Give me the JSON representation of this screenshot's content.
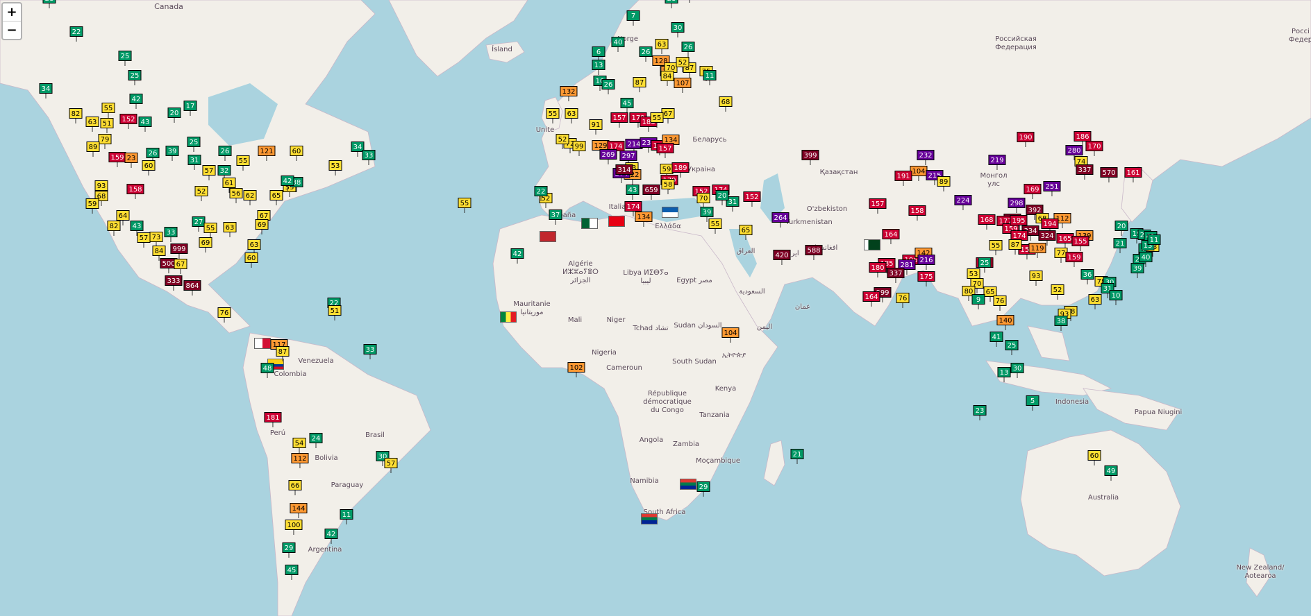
{
  "zoom": {
    "in_label": "+",
    "out_label": "−"
  },
  "labels": {
    "canada": "Canada",
    "island": "Ísland",
    "norge": "Norge",
    "uk": "Unite",
    "russia": "Российская\nФедерация",
    "russia_edge": "Россі\nФедер",
    "belarus": "Беларусь",
    "ukraine": "Украіна",
    "espana": "España",
    "italia": "Italia",
    "ellada": "Ελλάδα",
    "kazakhstan": "Қазақстан",
    "mongolia": "Монгол\nулс",
    "uzbekistan": "O'zbekiston",
    "turkmenistan": "Turkmenistan",
    "afghanistan": "افغانستان",
    "iraq": "العراق",
    "iran": "ایران",
    "saudi": "السعودية",
    "oman": "عمان",
    "yemen": "اليمن",
    "algerie": "Algérie\nⵍⵣⵣⴰⵢⴻⵔ\nالجزائر",
    "libya": "Libya ⵍⵉⴱⵢⴰ\nليبيا",
    "egypt": "Egypt مصر",
    "mauritanie": "Mauritanie\nموريتانيا",
    "mali": "Mali",
    "niger": "Niger",
    "tchad": "Tchad تشاد",
    "sudan": "Sudan السودان",
    "nigeria": "Nigeria",
    "cameroun": "Cameroun",
    "south_sudan": "South Sudan",
    "ethiopia": "ኢትዮጵያ",
    "kenya": "Kenya",
    "rdc": "République\ndémocratique\ndu Congo",
    "tanzania": "Tanzania",
    "angola": "Angola",
    "zambia": "Zambia",
    "mocambique": "Moçambique",
    "namibia": "Namibia",
    "south_africa": "South Africa",
    "venezuela": "Venezuela",
    "colombia": "Colombia",
    "brasil": "Brasil",
    "peru": "Perú",
    "bolivia": "Bolivia",
    "paraguay": "Paraguay",
    "argentina": "Argentina",
    "indonesia": "Indonesia",
    "papua": "Papua Niugini",
    "australia": "Australia",
    "new_zealand": "New Zealand/\nAotearoa"
  },
  "stations": [
    {
      "v": "28",
      "c": "g"
    },
    {
      "v": "22",
      "c": "g"
    },
    {
      "v": "25",
      "c": "g"
    },
    {
      "v": "25",
      "c": "g"
    },
    {
      "v": "34",
      "c": "g"
    },
    {
      "v": "82",
      "c": "y"
    },
    {
      "v": "55",
      "c": "y"
    },
    {
      "v": "63",
      "c": "y"
    },
    {
      "v": "51",
      "c": "y"
    },
    {
      "v": "152",
      "c": "r"
    },
    {
      "v": "43",
      "c": "g"
    },
    {
      "v": "42",
      "c": "g"
    },
    {
      "v": "20",
      "c": "g"
    },
    {
      "v": "17",
      "c": "g"
    },
    {
      "v": "79",
      "c": "y"
    },
    {
      "v": "89",
      "c": "y"
    },
    {
      "v": "159",
      "c": "r"
    },
    {
      "v": "23",
      "c": "o"
    },
    {
      "v": "26",
      "c": "g"
    },
    {
      "v": "39",
      "c": "g"
    },
    {
      "v": "25",
      "c": "g"
    },
    {
      "v": "26",
      "c": "g"
    },
    {
      "v": "121",
      "c": "o"
    },
    {
      "v": "60",
      "c": "y"
    },
    {
      "v": "55",
      "c": "y"
    },
    {
      "v": "34",
      "c": "g"
    },
    {
      "v": "33",
      "c": "g"
    },
    {
      "v": "60",
      "c": "y"
    },
    {
      "v": "31",
      "c": "g"
    },
    {
      "v": "57",
      "c": "y"
    },
    {
      "v": "32",
      "c": "g"
    },
    {
      "v": "158",
      "c": "r"
    },
    {
      "v": "93",
      "c": "y"
    },
    {
      "v": "68",
      "c": "y"
    },
    {
      "v": "52",
      "c": "y"
    },
    {
      "v": "61",
      "c": "y"
    },
    {
      "v": "56",
      "c": "y"
    },
    {
      "v": "62",
      "c": "y"
    },
    {
      "v": "65",
      "c": "y"
    },
    {
      "v": "53",
      "c": "y"
    },
    {
      "v": "38",
      "c": "g"
    },
    {
      "v": "42",
      "c": "g"
    },
    {
      "v": "53",
      "c": "y"
    },
    {
      "v": "59",
      "c": "y"
    },
    {
      "v": "64",
      "c": "y"
    },
    {
      "v": "82",
      "c": "y"
    },
    {
      "v": "43",
      "c": "g"
    },
    {
      "v": "57",
      "c": "y"
    },
    {
      "v": "73",
      "c": "y"
    },
    {
      "v": "33",
      "c": "g"
    },
    {
      "v": "27",
      "c": "g"
    },
    {
      "v": "55",
      "c": "y"
    },
    {
      "v": "63",
      "c": "y"
    },
    {
      "v": "67",
      "c": "y"
    },
    {
      "v": "69",
      "c": "y"
    },
    {
      "v": "84",
      "c": "y"
    },
    {
      "v": "999",
      "c": "d"
    },
    {
      "v": "69",
      "c": "y"
    },
    {
      "v": "63",
      "c": "y"
    },
    {
      "v": "60",
      "c": "y"
    },
    {
      "v": "500",
      "c": "d"
    },
    {
      "v": "67",
      "c": "y"
    },
    {
      "v": "333",
      "c": "d"
    },
    {
      "v": "864",
      "c": "d"
    },
    {
      "v": "76",
      "c": "y"
    },
    {
      "v": "22",
      "c": "g"
    },
    {
      "v": "51",
      "c": "y"
    },
    {
      "v": "33",
      "c": "g"
    },
    {
      "v": "117",
      "c": "o"
    },
    {
      "v": "87",
      "c": "y"
    },
    {
      "v": "48",
      "c": "g"
    },
    {
      "v": "181",
      "c": "r"
    },
    {
      "v": "24",
      "c": "g"
    },
    {
      "v": "54",
      "c": "y"
    },
    {
      "v": "112",
      "c": "o"
    },
    {
      "v": "30",
      "c": "g"
    },
    {
      "v": "57",
      "c": "y"
    },
    {
      "v": "66",
      "c": "y"
    },
    {
      "v": "144",
      "c": "o"
    },
    {
      "v": "100",
      "c": "y"
    },
    {
      "v": "11",
      "c": "g"
    },
    {
      "v": "42",
      "c": "g"
    },
    {
      "v": "29",
      "c": "g"
    },
    {
      "v": "45",
      "c": "g"
    },
    {
      "v": "55",
      "c": "y"
    },
    {
      "v": "42",
      "c": "g"
    },
    {
      "v": "102",
      "c": "o"
    },
    {
      "v": "104",
      "c": "o"
    },
    {
      "v": "29",
      "c": "g"
    },
    {
      "v": "21",
      "c": "g"
    },
    {
      "v": "7",
      "c": "g"
    },
    {
      "v": "28",
      "c": "g"
    },
    {
      "v": "27",
      "c": "g"
    },
    {
      "v": "30",
      "c": "g"
    },
    {
      "v": "40",
      "c": "g"
    },
    {
      "v": "6",
      "c": "g"
    },
    {
      "v": "26",
      "c": "g"
    },
    {
      "v": "63",
      "c": "y"
    },
    {
      "v": "26",
      "c": "g"
    },
    {
      "v": "79",
      "c": "o"
    },
    {
      "v": "128",
      "c": "o"
    },
    {
      "v": "70",
      "c": "y"
    },
    {
      "v": "87",
      "c": "y"
    },
    {
      "v": "52",
      "c": "y"
    },
    {
      "v": "75",
      "c": "y"
    },
    {
      "v": "11",
      "c": "g"
    },
    {
      "v": "13",
      "c": "g"
    },
    {
      "v": "10",
      "c": "g"
    },
    {
      "v": "26",
      "c": "g"
    },
    {
      "v": "87",
      "c": "y"
    },
    {
      "v": "84",
      "c": "y"
    },
    {
      "v": "107",
      "c": "o"
    },
    {
      "v": "68",
      "c": "y"
    },
    {
      "v": "132",
      "c": "o"
    },
    {
      "v": "45",
      "c": "g"
    },
    {
      "v": "55",
      "c": "y"
    },
    {
      "v": "63",
      "c": "y"
    },
    {
      "v": "67",
      "c": "y"
    },
    {
      "v": "91",
      "c": "y"
    },
    {
      "v": "157",
      "c": "r"
    },
    {
      "v": "179",
      "c": "r"
    },
    {
      "v": "186",
      "c": "r"
    },
    {
      "v": "55",
      "c": "y"
    },
    {
      "v": "72",
      "c": "y"
    },
    {
      "v": "52",
      "c": "y"
    },
    {
      "v": "99",
      "c": "y"
    },
    {
      "v": "129",
      "c": "o"
    },
    {
      "v": "174",
      "c": "r"
    },
    {
      "v": "214",
      "c": "p"
    },
    {
      "v": "231",
      "c": "p"
    },
    {
      "v": "184",
      "c": "r"
    },
    {
      "v": "134",
      "c": "o"
    },
    {
      "v": "157",
      "c": "r"
    },
    {
      "v": "269",
      "c": "p"
    },
    {
      "v": "297",
      "c": "p"
    },
    {
      "v": "73",
      "c": "y"
    },
    {
      "v": "122",
      "c": "o"
    },
    {
      "v": "59",
      "c": "y"
    },
    {
      "v": "274",
      "c": "p"
    },
    {
      "v": "314",
      "c": "d"
    },
    {
      "v": "189",
      "c": "r"
    },
    {
      "v": "179",
      "c": "r"
    },
    {
      "v": "58",
      "c": "y"
    },
    {
      "v": "152",
      "c": "r"
    },
    {
      "v": "174",
      "c": "r"
    },
    {
      "v": "31",
      "c": "g"
    },
    {
      "v": "70",
      "c": "y"
    },
    {
      "v": "20",
      "c": "g"
    },
    {
      "v": "152",
      "c": "r"
    },
    {
      "v": "52",
      "c": "y"
    },
    {
      "v": "22",
      "c": "g"
    },
    {
      "v": "37",
      "c": "g"
    },
    {
      "v": "43",
      "c": "g"
    },
    {
      "v": "659",
      "c": "d"
    },
    {
      "v": "174",
      "c": "r"
    },
    {
      "v": "134",
      "c": "o"
    },
    {
      "v": "65",
      "c": "y"
    },
    {
      "v": "39",
      "c": "g"
    },
    {
      "v": "55",
      "c": "y"
    },
    {
      "v": "264",
      "c": "p"
    },
    {
      "v": "399",
      "c": "d"
    },
    {
      "v": "232",
      "c": "p"
    },
    {
      "v": "104",
      "c": "o"
    },
    {
      "v": "215",
      "c": "p"
    },
    {
      "v": "191",
      "c": "r"
    },
    {
      "v": "89",
      "c": "y"
    },
    {
      "v": "157",
      "c": "r"
    },
    {
      "v": "158",
      "c": "r"
    },
    {
      "v": "164",
      "c": "r"
    },
    {
      "v": "588",
      "c": "d"
    },
    {
      "v": "420",
      "c": "d"
    },
    {
      "v": "185",
      "c": "r"
    },
    {
      "v": "196",
      "c": "r"
    },
    {
      "v": "281",
      "c": "p"
    },
    {
      "v": "142",
      "c": "o"
    },
    {
      "v": "216",
      "c": "p"
    },
    {
      "v": "180",
      "c": "r"
    },
    {
      "v": "337",
      "c": "d"
    },
    {
      "v": "175",
      "c": "r"
    },
    {
      "v": "999",
      "c": "d"
    },
    {
      "v": "164",
      "c": "r"
    },
    {
      "v": "76",
      "c": "y"
    },
    {
      "v": "219",
      "c": "p"
    },
    {
      "v": "190",
      "c": "r"
    },
    {
      "v": "280",
      "c": "p"
    },
    {
      "v": "186",
      "c": "r"
    },
    {
      "v": "170",
      "c": "r"
    },
    {
      "v": "74",
      "c": "y"
    },
    {
      "v": "337",
      "c": "d"
    },
    {
      "v": "570",
      "c": "d"
    },
    {
      "v": "161",
      "c": "r"
    },
    {
      "v": "169",
      "c": "r"
    },
    {
      "v": "251",
      "c": "p"
    },
    {
      "v": "298",
      "c": "p"
    },
    {
      "v": "224",
      "c": "p"
    },
    {
      "v": "392",
      "c": "d"
    },
    {
      "v": "550",
      "c": "d"
    },
    {
      "v": "177",
      "c": "r"
    },
    {
      "v": "68",
      "c": "y"
    },
    {
      "v": "112",
      "c": "o"
    },
    {
      "v": "159",
      "c": "r"
    },
    {
      "v": "334",
      "c": "d"
    },
    {
      "v": "174",
      "c": "r"
    },
    {
      "v": "182",
      "c": "r"
    },
    {
      "v": "168",
      "c": "r"
    },
    {
      "v": "195",
      "c": "r"
    },
    {
      "v": "194",
      "c": "r"
    },
    {
      "v": "324",
      "c": "d"
    },
    {
      "v": "139",
      "c": "o"
    },
    {
      "v": "165",
      "c": "r"
    },
    {
      "v": "155",
      "c": "r"
    },
    {
      "v": "158",
      "c": "r"
    },
    {
      "v": "77",
      "c": "y"
    },
    {
      "v": "159",
      "c": "r"
    },
    {
      "v": "55",
      "c": "y"
    },
    {
      "v": "25",
      "c": "g"
    },
    {
      "v": "53",
      "c": "y"
    },
    {
      "v": "87",
      "c": "y"
    },
    {
      "v": "119",
      "c": "o"
    },
    {
      "v": "70",
      "c": "y"
    },
    {
      "v": "80",
      "c": "y"
    },
    {
      "v": "93",
      "c": "y"
    },
    {
      "v": "65",
      "c": "y"
    },
    {
      "v": "9",
      "c": "g"
    },
    {
      "v": "52",
      "c": "y"
    },
    {
      "v": "76",
      "c": "y"
    },
    {
      "v": "140",
      "c": "o"
    },
    {
      "v": "63",
      "c": "y"
    },
    {
      "v": "98",
      "c": "y"
    },
    {
      "v": "93",
      "c": "y"
    },
    {
      "v": "38",
      "c": "g"
    },
    {
      "v": "36",
      "c": "g"
    },
    {
      "v": "78",
      "c": "y"
    },
    {
      "v": "30",
      "c": "g"
    },
    {
      "v": "31",
      "c": "g"
    },
    {
      "v": "10",
      "c": "g"
    },
    {
      "v": "21",
      "c": "g"
    },
    {
      "v": "19",
      "c": "g"
    },
    {
      "v": "20",
      "c": "g"
    },
    {
      "v": "20",
      "c": "g"
    },
    {
      "v": "41",
      "c": "g"
    },
    {
      "v": "41",
      "c": "g"
    },
    {
      "v": "20",
      "c": "g"
    },
    {
      "v": "39",
      "c": "g"
    },
    {
      "v": "53",
      "c": "y"
    },
    {
      "v": "13",
      "c": "g"
    },
    {
      "v": "11",
      "c": "g"
    },
    {
      "v": "40",
      "c": "g"
    },
    {
      "v": "41",
      "c": "g"
    },
    {
      "v": "25",
      "c": "g"
    },
    {
      "v": "30",
      "c": "g"
    },
    {
      "v": "13",
      "c": "g"
    },
    {
      "v": "5",
      "c": "g"
    },
    {
      "v": "23",
      "c": "g"
    },
    {
      "v": "60",
      "c": "y"
    },
    {
      "v": "49",
      "c": "g"
    }
  ]
}
